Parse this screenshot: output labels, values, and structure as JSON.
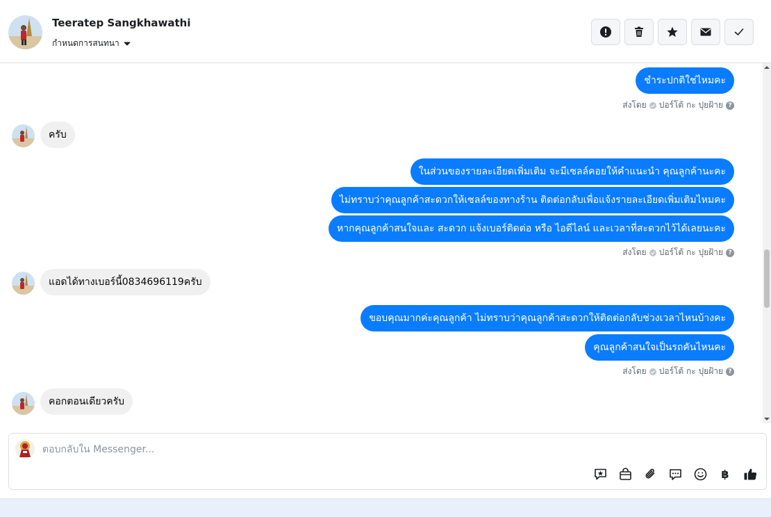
{
  "header": {
    "name": "Teeratep Sangkhawathi",
    "assign_label": "กำหนดการสนทนา",
    "actions": [
      "report-icon",
      "trash-icon",
      "star-icon",
      "envelope-icon",
      "check-icon"
    ]
  },
  "messages": {
    "m1": "ชำระปกติใช่ไหมคะ",
    "sent1": "ส่งโดย",
    "sender1": "ปอร์โต้ กะ ปุยฝ้าย",
    "in1": "ครับ",
    "m2": "ในส่วนของรายละเอียดเพิ่มเติม จะมีเซลล์คอยให้คำแนะนำ คุณลูกค้านะคะ",
    "m3": "ไม่ทราบว่าคุณลูกค้าสะดวกให้เซลล์ของทางร้าน ติดต่อกลับเพื่อแจ้งรายละเอียดเพิ่มเติมไหมคะ",
    "m4": "หากคุณลูกค้าสนใจและ สะดวก แจ้งเบอร์ติดต่อ หรือ ไอดีไลน์ และเวลาที่สะดวกไว้ได้เลยนะคะ",
    "sent2": "ส่งโดย",
    "sender2": "ปอร์โต้ กะ ปุยฝ้าย",
    "in2": "แอดได้ทางเบอร์นี้0834696119ครับ",
    "m5": "ขอบคุณมากค่ะคุณลูกค้า ไม่ทราบว่าคุณลูกค้าสะดวกให้ติดต่อกลับช่วงเวลาไหนบ้างคะ",
    "m6": "คุณลูกค้าสนใจเป็นรถคันไหนคะ",
    "sent3": "ส่งโดย",
    "sender3": "ปอร์โต้ กะ ปุยฝ้าย",
    "in3": "คอกตอนเดียวครับ"
  },
  "composer": {
    "placeholder": "ตอบกลับใน Messenger...",
    "baht_symbol": "฿",
    "tools": [
      "saved-reply-icon",
      "shopping-bag-icon",
      "attachment-icon",
      "chat-bubbles-icon",
      "smiley-icon",
      "baht-icon",
      "thumbs-up-icon"
    ]
  },
  "colors": {
    "outgoing_bubble": "#0a7cff",
    "incoming_bubble": "#f0f0f0",
    "border": "#dddfe2"
  }
}
